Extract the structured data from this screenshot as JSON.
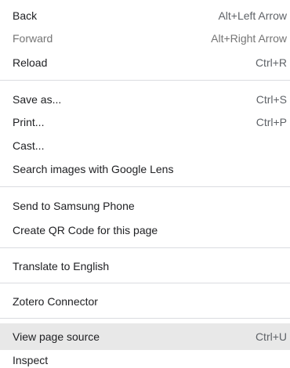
{
  "context_menu": {
    "items": [
      {
        "label": "Back",
        "shortcut": "Alt+Left Arrow"
      },
      {
        "label": "Forward",
        "shortcut": "Alt+Right Arrow"
      },
      {
        "label": "Reload",
        "shortcut": "Ctrl+R"
      },
      {
        "label": "Save as...",
        "shortcut": "Ctrl+S"
      },
      {
        "label": "Print...",
        "shortcut": "Ctrl+P"
      },
      {
        "label": "Cast..."
      },
      {
        "label": "Search images with Google Lens"
      },
      {
        "label": "Send to Samsung Phone"
      },
      {
        "label": "Create QR Code for this page"
      },
      {
        "label": "Translate to English"
      },
      {
        "label": "Zotero Connector"
      },
      {
        "label": "View page source",
        "shortcut": "Ctrl+U"
      },
      {
        "label": "Inspect"
      }
    ]
  },
  "colors": {
    "background": "#ffffff",
    "separator": "#dadce0",
    "hover": "#e8e8e8",
    "disabled_text": "#757575"
  }
}
